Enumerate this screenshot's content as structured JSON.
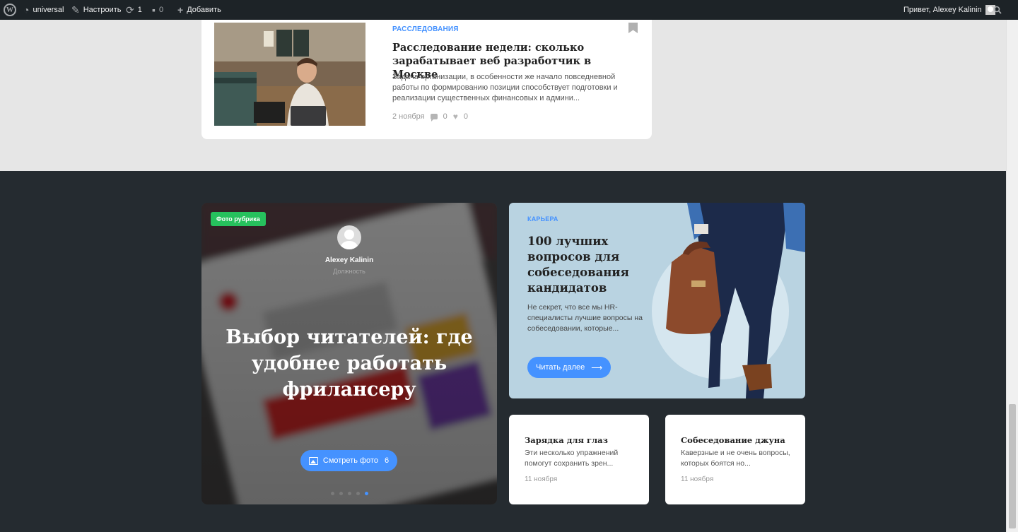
{
  "adminbar": {
    "site": "universal",
    "customize": "Настроить",
    "updates": "1",
    "comments": "0",
    "add_new": "Добавить",
    "greeting": "Привет, Alexey Kalinin"
  },
  "top_post": {
    "category": "РАССЛЕДОВАНИЯ",
    "title": "Расследование недели: сколько зарабатывает веб разработчик в Москве",
    "excerpt": "Задача организации, в особенности же начало повседневной работы по формированию позиции способствует подготовки и реализации существенных финансовых и админи...",
    "date": "2 ноября",
    "comments": "0",
    "likes": "0"
  },
  "photo_slider": {
    "tag": "Фото рубрика",
    "author_name": "Alexey Kalinin",
    "author_role": "Должность",
    "title": "Выбор читателей: где удобнее работать фрилансеру",
    "button_label": "Смотреть фото",
    "photo_count": "6",
    "slide_count": 5,
    "active_slide": 5
  },
  "career_post": {
    "category": "КАРЬЕРА",
    "title": "100 лучших вопросов для собеседования кандидатов",
    "excerpt": "Не секрет, что все мы HR-специалисты лучшие вопросы на собеседовании, которые...",
    "button_label": "Читать далее",
    "button_arrow": "⟶"
  },
  "small_posts": [
    {
      "title": "Зарядка для глаз",
      "excerpt": "Эти несколько упражнений помогут сохранить зрен...",
      "date": "11 ноября"
    },
    {
      "title": "Собеседование джуна",
      "excerpt": "Каверзные и не очень вопросы, которых боятся но...",
      "date": "11 ноября"
    }
  ],
  "colors": {
    "accent": "#4592ff",
    "photo_tag": "#26c15d",
    "dark_bg": "#252b30",
    "admin_bar": "#1d2327",
    "career_bg": "#b9d3e1"
  }
}
